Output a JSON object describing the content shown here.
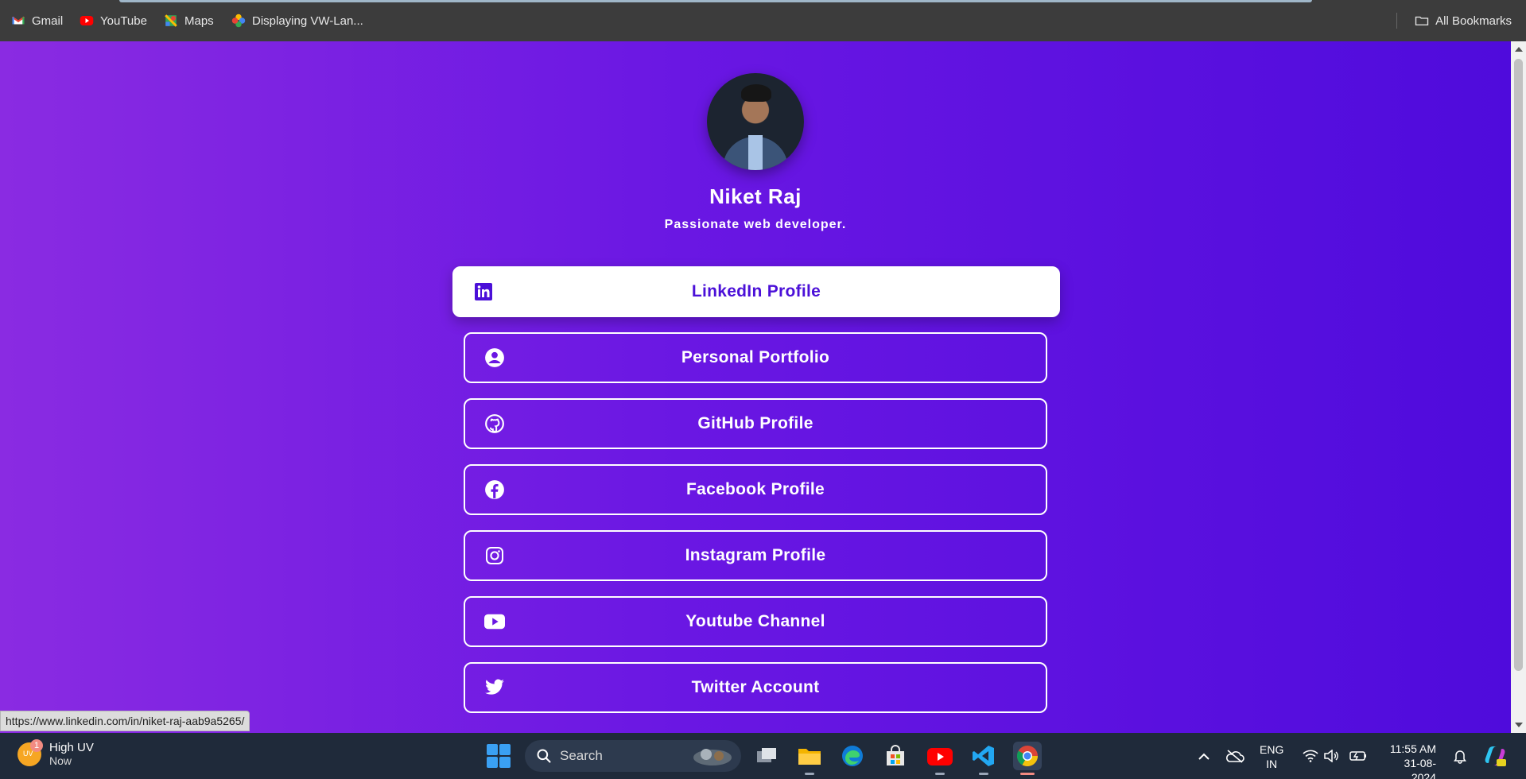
{
  "bookmarks": {
    "items": [
      {
        "label": "Gmail",
        "icon": "gmail-icon"
      },
      {
        "label": "YouTube",
        "icon": "youtube-icon"
      },
      {
        "label": "Maps",
        "icon": "maps-icon"
      },
      {
        "label": "Displaying VW-Lan...",
        "icon": "photos-icon"
      }
    ],
    "all_bookmarks": "All Bookmarks"
  },
  "profile": {
    "name": "Niket Raj",
    "tagline": "Passionate web developer."
  },
  "links": [
    {
      "label": "LinkedIn Profile",
      "icon": "linkedin-icon",
      "active": true
    },
    {
      "label": "Personal Portfolio",
      "icon": "user-circle-icon",
      "active": false
    },
    {
      "label": "GitHub Profile",
      "icon": "github-icon",
      "active": false
    },
    {
      "label": "Facebook Profile",
      "icon": "facebook-icon",
      "active": false
    },
    {
      "label": "Instagram Profile",
      "icon": "instagram-icon",
      "active": false
    },
    {
      "label": "Youtube Channel",
      "icon": "youtube-icon",
      "active": false
    },
    {
      "label": "Twitter Account",
      "icon": "twitter-icon",
      "active": false
    }
  ],
  "status_url": "https://www.linkedin.com/in/niket-raj-aab9a5265/",
  "taskbar": {
    "weather": {
      "title": "High UV",
      "subtitle": "Now",
      "badge": "1",
      "icon_text": "UV"
    },
    "search_placeholder": "Search",
    "lang_line1": "ENG",
    "lang_line2": "IN",
    "time": "11:55 AM",
    "date": "31-08-2024"
  },
  "colors": {
    "gradient_start": "#8a2be2",
    "gradient_end": "#4f0bdc",
    "active_text": "#4b10d8"
  }
}
